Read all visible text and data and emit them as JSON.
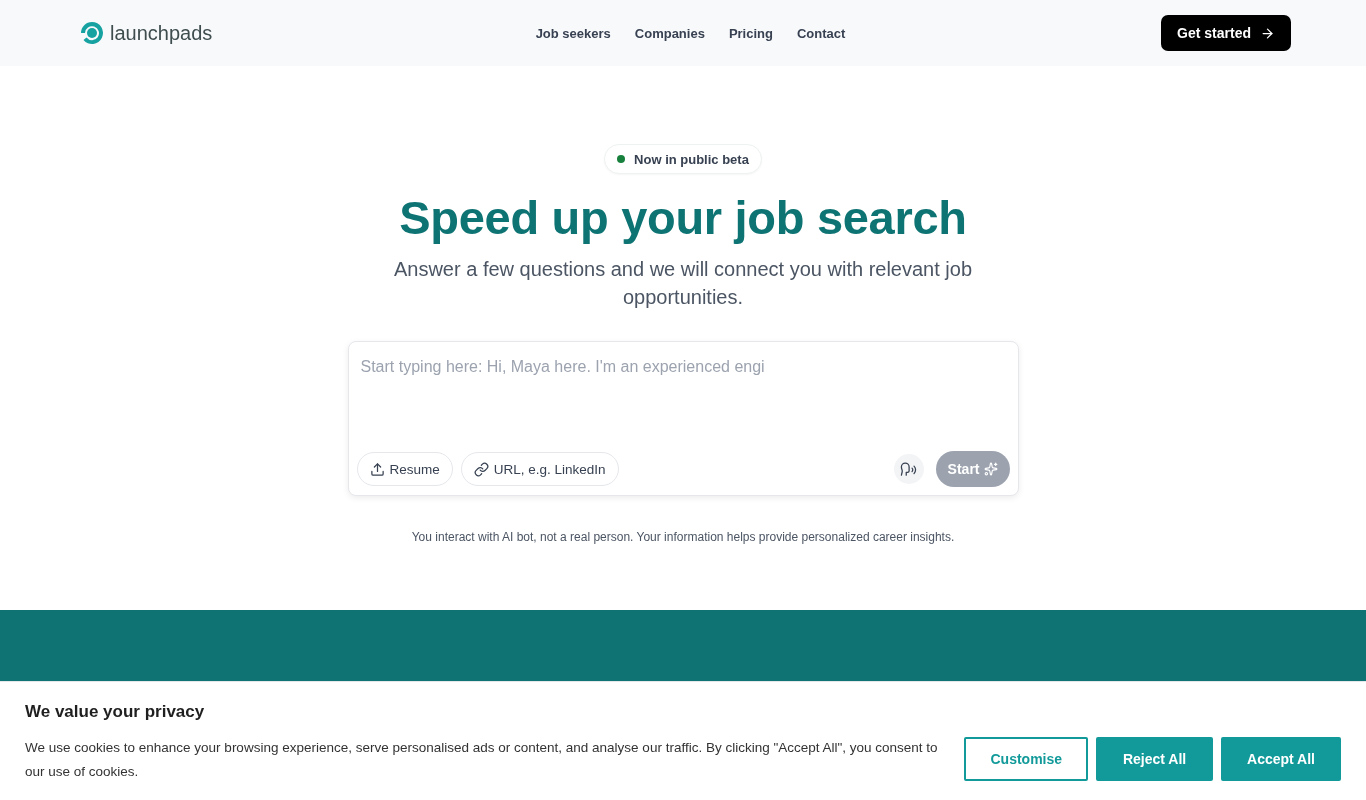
{
  "header": {
    "logo": "launchpads",
    "nav": [
      "Job seekers",
      "Companies",
      "Pricing",
      "Contact"
    ],
    "cta": "Get started"
  },
  "hero": {
    "badge": "Now in public beta",
    "title": "Speed up your job search",
    "subtitle": "Answer a few questions and we will connect you with relevant job opportunities."
  },
  "composer": {
    "placeholder": "Start typing here: Hi, Maya here. I'm an experienced engi",
    "attachments": [
      {
        "kind": "upload",
        "label": "Resume"
      },
      {
        "kind": "link",
        "label": "URL, e.g. LinkedIn"
      }
    ],
    "start_button": {
      "label": "Start",
      "disabled": true
    }
  },
  "disclaimer": "You interact with AI bot, not a real person. Your information helps provide personalized career insights.",
  "cookie_banner": {
    "title": "We value your privacy",
    "text": "We use cookies to enhance your browsing experience, serve personalised ads or content, and analyse our traffic. By clicking \"Accept All\", you consent to our use of cookies.",
    "buttons": [
      {
        "kind": "outline",
        "label": "Customise"
      },
      {
        "kind": "solid",
        "label": "Reject All"
      },
      {
        "kind": "solid",
        "label": "Accept All"
      }
    ]
  }
}
